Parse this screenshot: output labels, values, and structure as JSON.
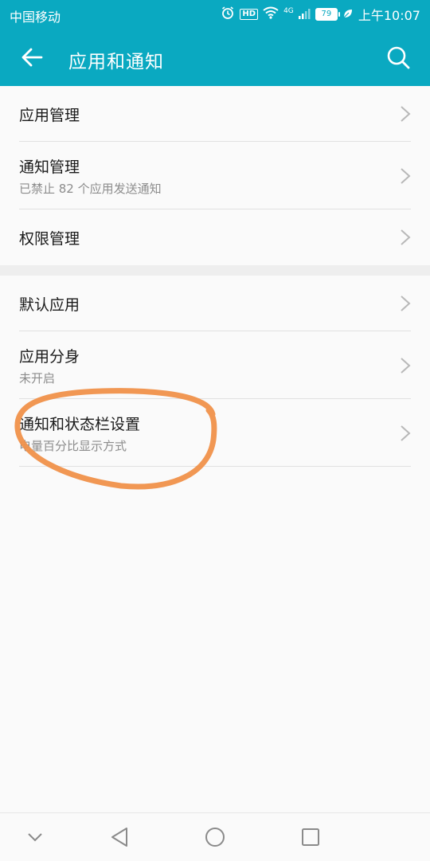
{
  "status_bar": {
    "carrier": "中国移动",
    "hd_badge": "HD",
    "network_type": "4G",
    "battery": "79",
    "time": "上午10:07",
    "icons": [
      "alarm-icon",
      "hd-icon",
      "wifi-icon",
      "signal-icon",
      "battery-icon",
      "leaf-icon"
    ]
  },
  "toolbar": {
    "title": "应用和通知",
    "back_icon": "arrow-left-icon",
    "search_icon": "search-icon",
    "background_color": "#0aa9c1"
  },
  "groups": [
    {
      "items": [
        {
          "title": "应用管理",
          "subtitle": ""
        },
        {
          "title": "通知管理",
          "subtitle": "已禁止 82 个应用发送通知"
        },
        {
          "title": "权限管理",
          "subtitle": ""
        }
      ]
    },
    {
      "items": [
        {
          "title": "默认应用",
          "subtitle": ""
        },
        {
          "title": "应用分身",
          "subtitle": "未开启"
        },
        {
          "title": "通知和状态栏设置",
          "subtitle": "电量百分比显示方式"
        }
      ]
    }
  ],
  "annotation": {
    "color": "#f0914a",
    "icon": "hand-drawn-circle"
  },
  "nav_bar": {
    "icons": [
      "chevron-down-icon",
      "back-triangle-icon",
      "home-circle-icon",
      "recents-square-icon"
    ]
  }
}
